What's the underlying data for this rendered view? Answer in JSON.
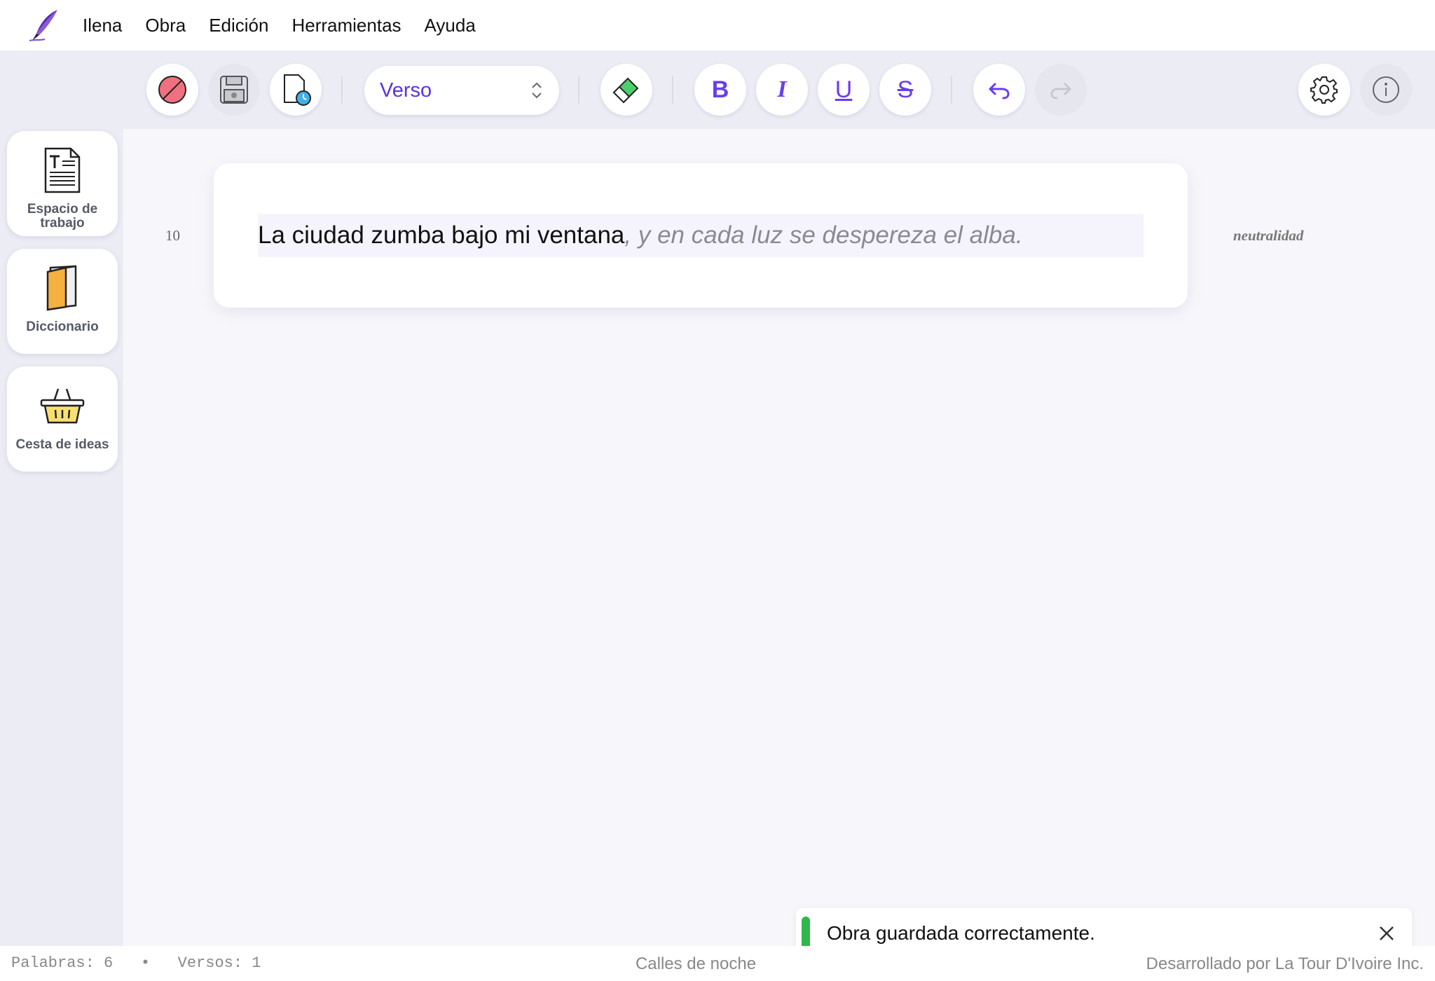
{
  "app": {
    "name": "Ilena"
  },
  "menu": {
    "items": [
      "Ilena",
      "Obra",
      "Edición",
      "Herramientas",
      "Ayuda"
    ]
  },
  "toolbar": {
    "style_select": {
      "value": "Verso"
    },
    "format": {
      "bold": "B",
      "italic": "I",
      "underline": "U",
      "strike": "S"
    }
  },
  "sidebar": {
    "items": [
      {
        "label": "Espacio de trabajo",
        "icon": "document-text-icon"
      },
      {
        "label": "Diccionario",
        "icon": "book-icon"
      },
      {
        "label": "Cesta de ideas",
        "icon": "basket-icon"
      }
    ]
  },
  "editor": {
    "line_number": "10",
    "verse_text": "La ciudad zumba bajo mi ventana",
    "suggestion": ", y en cada luz se desperezа el alba.",
    "margin_note": "neutralidad"
  },
  "toast": {
    "message": "Obra guardada correctamente."
  },
  "statusbar": {
    "words": "Palabras: 6",
    "separator": "•",
    "verses": "Versos: 1",
    "work_title": "Calles de noche",
    "credit": "Desarrollado por La Tour D'Ivoire Inc."
  },
  "colors": {
    "accent": "#5b32e0",
    "toast_success": "#2fb84a",
    "chrome_bg": "#ececf5",
    "editor_bg": "#f7f7fb"
  }
}
